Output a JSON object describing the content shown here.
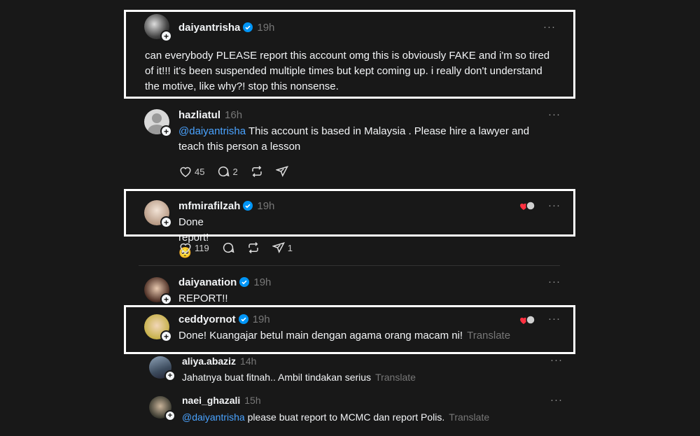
{
  "threads": [
    {
      "username": "daiyantrisha",
      "verified": true,
      "time": "19h",
      "text": "can everybody PLEASE report this account omg this is obviously FAKE and i'm so tired of it!!! it's been suspended multiple times but kept coming up. i really don't understand the motive, like why?! stop this nonsense."
    },
    {
      "username": "hazliatul",
      "verified": false,
      "time": "16h",
      "mention": "@daiyantrisha",
      "text": " This account is based in Malaysia . Please hire a lawyer and teach this person a lesson",
      "likes": "45",
      "replies": "2"
    },
    {
      "username": "mfmirafilzah",
      "verified": true,
      "time": "19h",
      "text": "Done report! 🥺",
      "likes": "119",
      "shares": "1"
    },
    {
      "username": "daiyanation",
      "verified": true,
      "time": "19h",
      "text": "REPORT!!"
    },
    {
      "username": "ceddyornot",
      "verified": true,
      "time": "19h",
      "text": "Done! Kuangajar betul main dengan agama orang macam ni!",
      "translate": "Translate"
    },
    {
      "username": "aliya.abaziz",
      "verified": false,
      "time": "14h",
      "text": "Jahatnya buat fitnah.. Ambil tindakan serius",
      "translate": "Translate"
    },
    {
      "username": "naei_ghazali",
      "verified": false,
      "time": "15h",
      "mention": "@daiyantrisha",
      "text": " please buat report to MCMC dan report Polis.",
      "translate": "Translate"
    }
  ],
  "more_label": "···",
  "colors": {
    "accent": "#4aa3ff",
    "frame": "#ffffff",
    "bg": "#181818"
  }
}
